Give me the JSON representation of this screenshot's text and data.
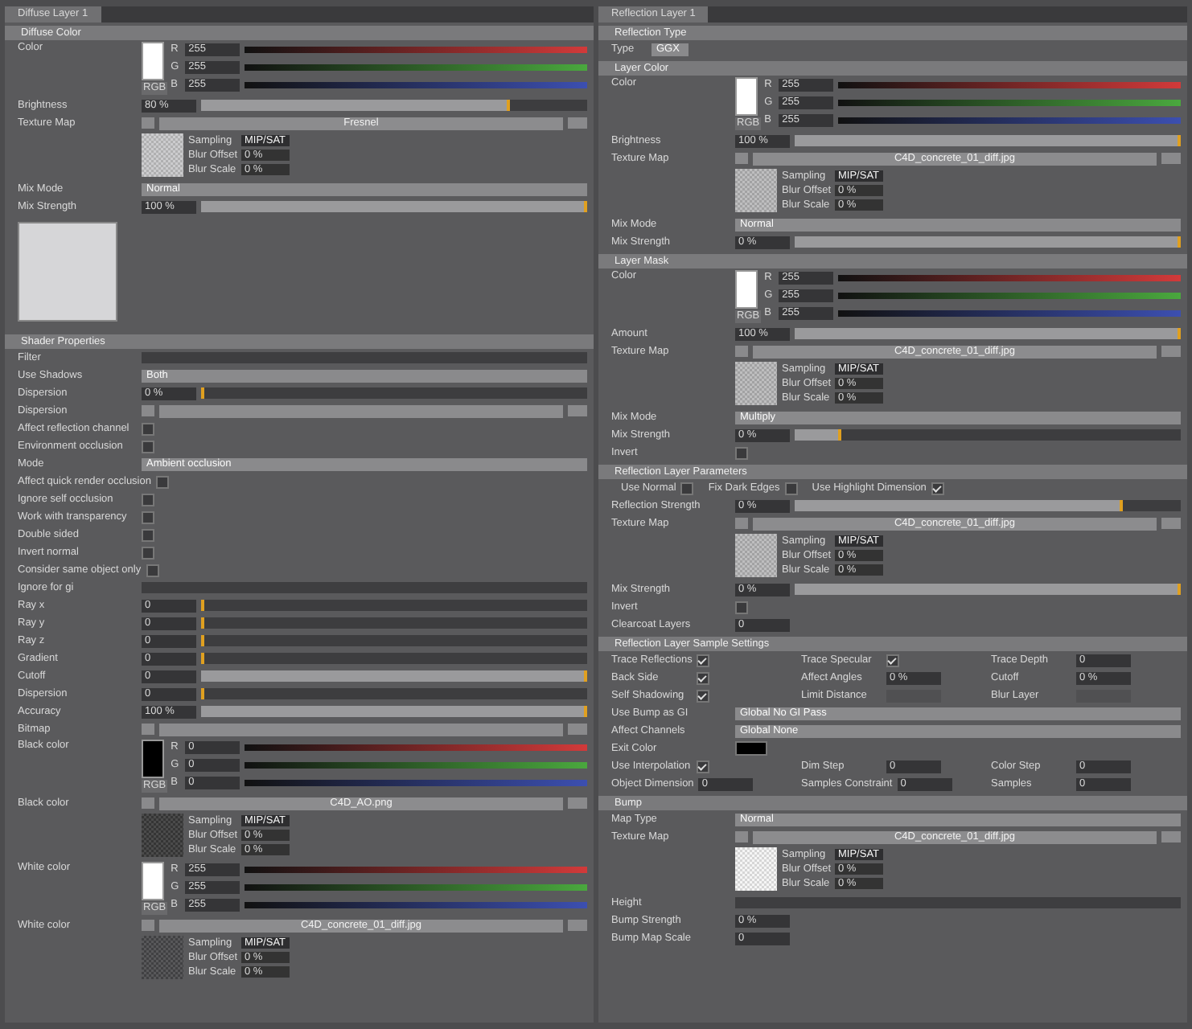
{
  "panels": [
    {
      "tab": "Diffuse Layer 1",
      "sections": [
        {
          "title": "Diffuse Color",
          "rows": [
            {
              "kind": "color",
              "label": "Color",
              "color": "#ffffff",
              "mode": "RGB",
              "channels": [
                {
                  "name": "R",
                  "value": "255"
                },
                {
                  "name": "G",
                  "value": "255"
                },
                {
                  "name": "B",
                  "value": "255"
                }
              ]
            },
            {
              "kind": "slider",
              "label": "Brightness",
              "value": "80 %",
              "level": 0.8
            },
            {
              "kind": "texture",
              "label": "Texture Map",
              "file": "Fresnel",
              "color": "#c8c8ca",
              "params": [
                {
                  "label": "Sampling",
                  "value": "MIP/SAT"
                },
                {
                  "label": "Blur Offset",
                  "value": "0 %"
                },
                {
                  "label": "Blur Scale",
                  "value": "0 %"
                }
              ]
            },
            {
              "kind": "dropdown",
              "label": "Mix Mode",
              "value": "Normal"
            },
            {
              "kind": "slider",
              "label": "Mix Strength",
              "value": "100 %",
              "level": 1
            },
            {
              "kind": "preview"
            }
          ]
        },
        {
          "title": "Shader Properties",
          "rows": [
            {
              "kind": "bar",
              "label": "Filter"
            },
            {
              "kind": "dropdown",
              "label": "Use Shadows",
              "value": "Both"
            },
            {
              "kind": "slider",
              "label": "Dispersion",
              "value": "0 %",
              "level": 0
            },
            {
              "kind": "texture",
              "label": "Dispersion",
              "file": ""
            },
            {
              "kind": "check",
              "label": "Affect reflection channel",
              "checked": false
            },
            {
              "kind": "check",
              "label": "Environment occlusion",
              "checked": false
            },
            {
              "kind": "dropdown",
              "label": "Mode",
              "value": "Ambient occlusion"
            },
            {
              "kind": "check",
              "label": "Affect quick render occlusion",
              "checked": false
            },
            {
              "kind": "check",
              "label": "Ignore self occlusion",
              "checked": false
            },
            {
              "kind": "check",
              "label": "Work with transparency",
              "checked": false
            },
            {
              "kind": "check",
              "label": "Double sided",
              "checked": false
            },
            {
              "kind": "check",
              "label": "Invert normal",
              "checked": false
            },
            {
              "kind": "check",
              "label": "Consider same object only",
              "checked": false
            },
            {
              "kind": "bar",
              "label": "Ignore for gi"
            },
            {
              "kind": "slider",
              "label": "Ray x",
              "value": "0",
              "level": 0
            },
            {
              "kind": "slider",
              "label": "Ray y",
              "value": "0",
              "level": 0
            },
            {
              "kind": "slider",
              "label": "Ray z",
              "value": "0",
              "level": 0
            },
            {
              "kind": "slider",
              "label": "Gradient",
              "value": "0",
              "level": 0
            },
            {
              "kind": "slider",
              "label": "Cutoff",
              "value": "0",
              "level": 1
            },
            {
              "kind": "slider",
              "label": "Dispersion",
              "value": "0",
              "level": 0
            },
            {
              "kind": "slider",
              "label": "Accuracy",
              "value": "100 %",
              "level": 1
            },
            {
              "kind": "texture",
              "label": "Bitmap",
              "file": ""
            },
            {
              "kind": "color",
              "label": "Black color",
              "color": "#000000",
              "mode": "RGB",
              "channels": [
                {
                  "name": "R",
                  "value": "0"
                },
                {
                  "name": "G",
                  "value": "0"
                },
                {
                  "name": "B",
                  "value": "0"
                }
              ]
            },
            {
              "kind": "texture",
              "label": "Black color",
              "file": "C4D_AO.png",
              "color": "#3c3c3c",
              "params": [
                {
                  "label": "Sampling",
                  "value": "MIP/SAT"
                },
                {
                  "label": "Blur Offset",
                  "value": "0 %"
                },
                {
                  "label": "Blur Scale",
                  "value": "0 %"
                }
              ]
            },
            {
              "kind": "color",
              "label": "White color",
              "color": "#ffffff",
              "mode": "RGB",
              "channels": [
                {
                  "name": "R",
                  "value": "255"
                },
                {
                  "name": "G",
                  "value": "255"
                },
                {
                  "name": "B",
                  "value": "255"
                }
              ]
            },
            {
              "kind": "texture",
              "label": "White color",
              "file": "C4D_concrete_01_diff.jpg",
              "color": "#4a4a4c",
              "params": [
                {
                  "label": "Sampling",
                  "value": "MIP/SAT"
                },
                {
                  "label": "Blur Offset",
                  "value": "0 %"
                },
                {
                  "label": "Blur Scale",
                  "value": "0 %"
                }
              ]
            }
          ]
        }
      ]
    },
    {
      "tab": "Reflection Layer 1",
      "sections": [
        {
          "title": "Reflection Type",
          "rows": [
            {
              "kind": "dropdown",
              "label": "Type",
              "value": "GGX",
              "short": true
            }
          ]
        },
        {
          "title": "Layer Color",
          "rows": [
            {
              "kind": "color",
              "label": "Color",
              "color": "#ffffff",
              "mode": "RGB",
              "channels": [
                {
                  "name": "R",
                  "value": "255"
                },
                {
                  "name": "G",
                  "value": "255"
                },
                {
                  "name": "B",
                  "value": "255"
                }
              ]
            },
            {
              "kind": "slider",
              "label": "Brightness",
              "value": "100 %",
              "level": 1
            },
            {
              "kind": "texture",
              "label": "Texture Map",
              "file": "C4D_concrete_01_diff.jpg",
              "color": "#b8b8ba",
              "params": [
                {
                  "label": "Sampling",
                  "value": "MIP/SAT"
                },
                {
                  "label": "Blur Offset",
                  "value": "0 %"
                },
                {
                  "label": "Blur Scale",
                  "value": "0 %"
                }
              ]
            },
            {
              "kind": "dropdown",
              "label": "Mix Mode",
              "value": "Normal"
            },
            {
              "kind": "slider",
              "label": "Mix Strength",
              "value": "0 %",
              "level": 1
            }
          ]
        },
        {
          "title": "Layer Mask",
          "rows": [
            {
              "kind": "color",
              "label": "Color",
              "color": "#ffffff",
              "mode": "RGB",
              "channels": [
                {
                  "name": "R",
                  "value": "255"
                },
                {
                  "name": "G",
                  "value": "255"
                },
                {
                  "name": "B",
                  "value": "255"
                }
              ]
            },
            {
              "kind": "slider",
              "label": "Amount",
              "value": "100 %",
              "level": 1
            },
            {
              "kind": "texture",
              "label": "Texture Map",
              "file": "C4D_concrete_01_diff.jpg",
              "color": "#b8b8ba",
              "params": [
                {
                  "label": "Sampling",
                  "value": "MIP/SAT"
                },
                {
                  "label": "Blur Offset",
                  "value": "0 %"
                },
                {
                  "label": "Blur Scale",
                  "value": "0 %"
                }
              ]
            },
            {
              "kind": "dropdown",
              "label": "Mix Mode",
              "value": "Multiply"
            },
            {
              "kind": "slider",
              "label": "Mix Strength",
              "value": "0 %",
              "level": 0.12
            },
            {
              "kind": "check",
              "label": "Invert",
              "checked": false
            }
          ]
        },
        {
          "title": "Reflection Layer Parameters",
          "rows": [
            {
              "kind": "checks",
              "items": [
                {
                  "label": "Use Normal",
                  "checked": false
                },
                {
                  "label": "Fix Dark Edges",
                  "checked": false
                },
                {
                  "label": "Use Highlight Dimension",
                  "checked": true
                }
              ]
            },
            {
              "kind": "slider",
              "label": "Reflection Strength",
              "value": "0 %",
              "level": 0.85
            },
            {
              "kind": "texture",
              "label": "Texture Map",
              "file": "C4D_concrete_01_diff.jpg",
              "color": "#b8b8ba",
              "params": [
                {
                  "label": "Sampling",
                  "value": "MIP/SAT"
                },
                {
                  "label": "Blur Offset",
                  "value": "0 %"
                },
                {
                  "label": "Blur Scale",
                  "value": "0 %"
                }
              ]
            },
            {
              "kind": "slider",
              "label": "Mix Strength",
              "value": "0 %",
              "level": 1
            },
            {
              "kind": "check",
              "label": "Invert",
              "checked": false
            },
            {
              "kind": "field",
              "label": "Clearcoat Layers",
              "value": "0"
            }
          ]
        },
        {
          "title": "Reflection Layer Sample Settings",
          "rows": [
            {
              "kind": "grid",
              "cells": [
                {
                  "label": "Trace Reflections",
                  "checked": true
                },
                {
                  "label": "Trace Specular",
                  "checked": true
                },
                {
                  "label": "Trace Depth",
                  "value": "0"
                },
                {
                  "label": "Back Side",
                  "checked": true
                },
                {
                  "label": "Affect Angles",
                  "value": "0 %"
                },
                {
                  "label": "Cutoff",
                  "value": "0 %"
                },
                {
                  "label": "Self Shadowing",
                  "checked": true
                },
                {
                  "label": "Limit Distance"
                },
                {
                  "label": "Blur Layer"
                }
              ]
            },
            {
              "kind": "dropdown",
              "label": "Use Bump as GI",
              "value": "Global No GI Pass"
            },
            {
              "kind": "dropdown",
              "label": "Affect Channels",
              "value": "Global None"
            },
            {
              "kind": "swatch",
              "label": "Exit Color",
              "color": "#000000"
            },
            {
              "kind": "grid",
              "cells": [
                {
                  "label": "Use Interpolation",
                  "checked": true
                },
                {
                  "label": "Dim Step",
                  "value": "0"
                },
                {
                  "label": "Color Step",
                  "value": "0"
                },
                {
                  "label": "Object Dimension",
                  "value": "0"
                },
                {
                  "label": "Samples Constraint",
                  "value": "0"
                },
                {
                  "label": "Samples",
                  "value": "0"
                }
              ]
            }
          ]
        },
        {
          "title": "Bump",
          "rows": [
            {
              "kind": "dropdown",
              "label": "Map Type",
              "value": "Normal"
            },
            {
              "kind": "texture",
              "label": "Texture Map",
              "file": "C4D_concrete_01_diff.jpg",
              "color": "#f4f4f4",
              "params": [
                {
                  "label": "Sampling",
                  "value": "MIP/SAT"
                },
                {
                  "label": "Blur Offset",
                  "value": "0 %"
                },
                {
                  "label": "Blur Scale",
                  "value": "0 %"
                }
              ]
            },
            {
              "kind": "bar",
              "label": "Height"
            },
            {
              "kind": "field",
              "label": "Bump Strength",
              "value": "0 %"
            },
            {
              "kind": "field",
              "label": "Bump Map Scale",
              "value": "0"
            }
          ]
        }
      ]
    }
  ]
}
